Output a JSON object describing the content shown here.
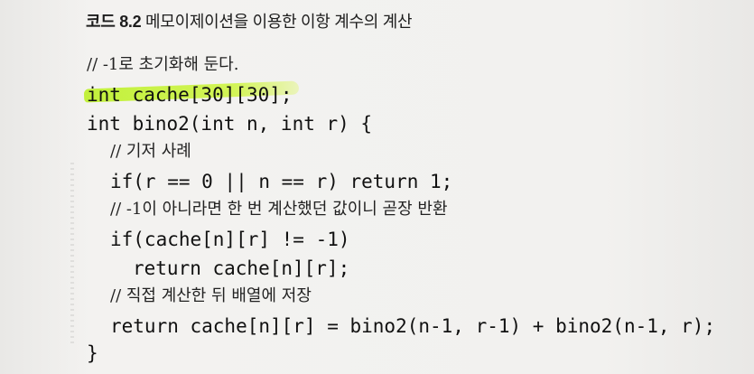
{
  "title": {
    "label": "코드 8.2",
    "text": "메모이제이션을 이용한 이항 계수의 계산"
  },
  "code": {
    "line1": "// -1로 초기화해 둔다.",
    "line2": "int cache[30][30];",
    "line3": "int bino2(int n, int r) {",
    "line4": "// 기저 사례",
    "line5": "if(r == 0 || n == r) return 1;",
    "line6": "// -1이 아니라면 한 번 계산했던 값이니 곧장 반환",
    "line7": "if(cache[n][r] != -1)",
    "line8": "return cache[n][r];",
    "line9": "// 직접 계산한 뒤 배열에 저장",
    "line10": "return cache[n][r] = bino2(n-1, r-1) + bino2(n-1, r);",
    "line11": "}"
  },
  "colors": {
    "highlight": "#c8f03a",
    "text": "#111111",
    "paper": "#f2f1ef"
  }
}
